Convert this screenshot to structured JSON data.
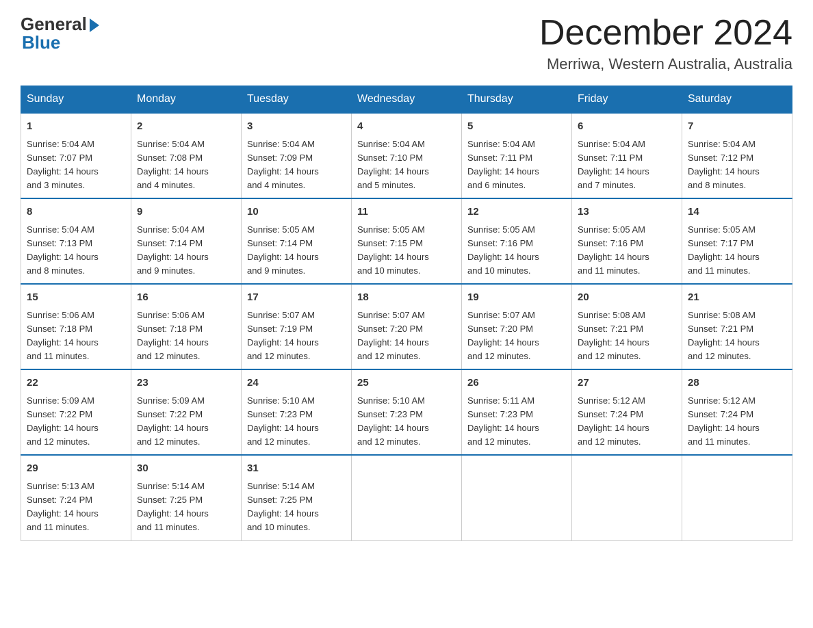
{
  "header": {
    "logo_general": "General",
    "logo_blue": "Blue",
    "month_title": "December 2024",
    "location": "Merriwa, Western Australia, Australia"
  },
  "days_of_week": [
    "Sunday",
    "Monday",
    "Tuesday",
    "Wednesday",
    "Thursday",
    "Friday",
    "Saturday"
  ],
  "weeks": [
    [
      {
        "day": "1",
        "sunrise": "5:04 AM",
        "sunset": "7:07 PM",
        "daylight": "14 hours and 3 minutes."
      },
      {
        "day": "2",
        "sunrise": "5:04 AM",
        "sunset": "7:08 PM",
        "daylight": "14 hours and 4 minutes."
      },
      {
        "day": "3",
        "sunrise": "5:04 AM",
        "sunset": "7:09 PM",
        "daylight": "14 hours and 4 minutes."
      },
      {
        "day": "4",
        "sunrise": "5:04 AM",
        "sunset": "7:10 PM",
        "daylight": "14 hours and 5 minutes."
      },
      {
        "day": "5",
        "sunrise": "5:04 AM",
        "sunset": "7:11 PM",
        "daylight": "14 hours and 6 minutes."
      },
      {
        "day": "6",
        "sunrise": "5:04 AM",
        "sunset": "7:11 PM",
        "daylight": "14 hours and 7 minutes."
      },
      {
        "day": "7",
        "sunrise": "5:04 AM",
        "sunset": "7:12 PM",
        "daylight": "14 hours and 8 minutes."
      }
    ],
    [
      {
        "day": "8",
        "sunrise": "5:04 AM",
        "sunset": "7:13 PM",
        "daylight": "14 hours and 8 minutes."
      },
      {
        "day": "9",
        "sunrise": "5:04 AM",
        "sunset": "7:14 PM",
        "daylight": "14 hours and 9 minutes."
      },
      {
        "day": "10",
        "sunrise": "5:05 AM",
        "sunset": "7:14 PM",
        "daylight": "14 hours and 9 minutes."
      },
      {
        "day": "11",
        "sunrise": "5:05 AM",
        "sunset": "7:15 PM",
        "daylight": "14 hours and 10 minutes."
      },
      {
        "day": "12",
        "sunrise": "5:05 AM",
        "sunset": "7:16 PM",
        "daylight": "14 hours and 10 minutes."
      },
      {
        "day": "13",
        "sunrise": "5:05 AM",
        "sunset": "7:16 PM",
        "daylight": "14 hours and 11 minutes."
      },
      {
        "day": "14",
        "sunrise": "5:05 AM",
        "sunset": "7:17 PM",
        "daylight": "14 hours and 11 minutes."
      }
    ],
    [
      {
        "day": "15",
        "sunrise": "5:06 AM",
        "sunset": "7:18 PM",
        "daylight": "14 hours and 11 minutes."
      },
      {
        "day": "16",
        "sunrise": "5:06 AM",
        "sunset": "7:18 PM",
        "daylight": "14 hours and 12 minutes."
      },
      {
        "day": "17",
        "sunrise": "5:07 AM",
        "sunset": "7:19 PM",
        "daylight": "14 hours and 12 minutes."
      },
      {
        "day": "18",
        "sunrise": "5:07 AM",
        "sunset": "7:20 PM",
        "daylight": "14 hours and 12 minutes."
      },
      {
        "day": "19",
        "sunrise": "5:07 AM",
        "sunset": "7:20 PM",
        "daylight": "14 hours and 12 minutes."
      },
      {
        "day": "20",
        "sunrise": "5:08 AM",
        "sunset": "7:21 PM",
        "daylight": "14 hours and 12 minutes."
      },
      {
        "day": "21",
        "sunrise": "5:08 AM",
        "sunset": "7:21 PM",
        "daylight": "14 hours and 12 minutes."
      }
    ],
    [
      {
        "day": "22",
        "sunrise": "5:09 AM",
        "sunset": "7:22 PM",
        "daylight": "14 hours and 12 minutes."
      },
      {
        "day": "23",
        "sunrise": "5:09 AM",
        "sunset": "7:22 PM",
        "daylight": "14 hours and 12 minutes."
      },
      {
        "day": "24",
        "sunrise": "5:10 AM",
        "sunset": "7:23 PM",
        "daylight": "14 hours and 12 minutes."
      },
      {
        "day": "25",
        "sunrise": "5:10 AM",
        "sunset": "7:23 PM",
        "daylight": "14 hours and 12 minutes."
      },
      {
        "day": "26",
        "sunrise": "5:11 AM",
        "sunset": "7:23 PM",
        "daylight": "14 hours and 12 minutes."
      },
      {
        "day": "27",
        "sunrise": "5:12 AM",
        "sunset": "7:24 PM",
        "daylight": "14 hours and 12 minutes."
      },
      {
        "day": "28",
        "sunrise": "5:12 AM",
        "sunset": "7:24 PM",
        "daylight": "14 hours and 11 minutes."
      }
    ],
    [
      {
        "day": "29",
        "sunrise": "5:13 AM",
        "sunset": "7:24 PM",
        "daylight": "14 hours and 11 minutes."
      },
      {
        "day": "30",
        "sunrise": "5:14 AM",
        "sunset": "7:25 PM",
        "daylight": "14 hours and 11 minutes."
      },
      {
        "day": "31",
        "sunrise": "5:14 AM",
        "sunset": "7:25 PM",
        "daylight": "14 hours and 10 minutes."
      },
      null,
      null,
      null,
      null
    ]
  ],
  "labels": {
    "sunrise": "Sunrise:",
    "sunset": "Sunset:",
    "daylight": "Daylight:"
  }
}
